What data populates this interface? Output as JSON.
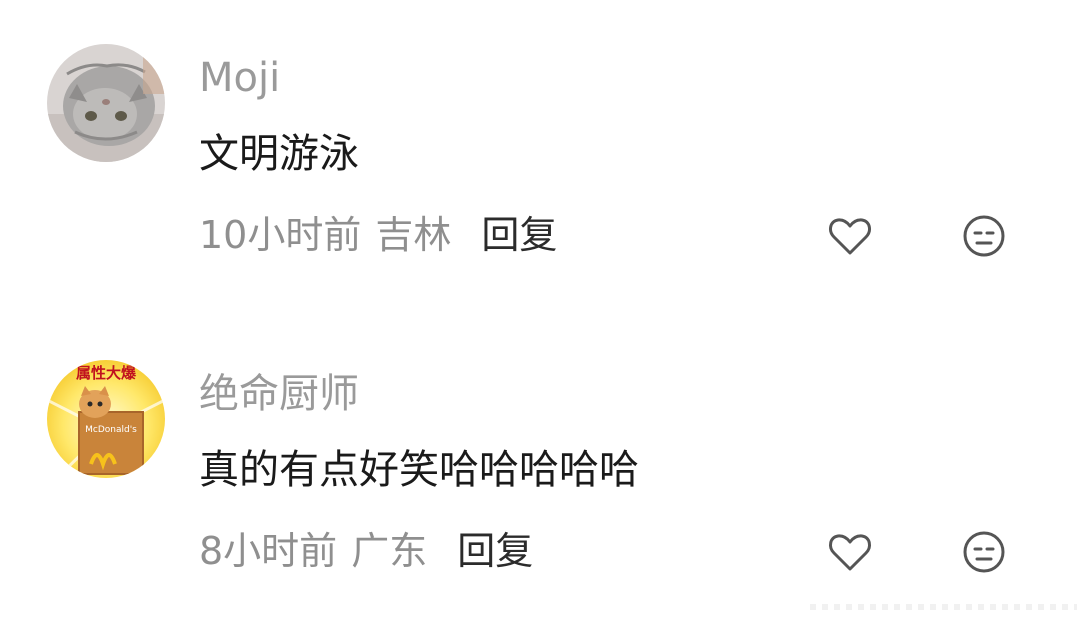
{
  "comments": [
    {
      "username": "Moji",
      "avatar_icon": "cat-avatar-icon",
      "text": "文明游泳",
      "time": "10小时前",
      "location": "吉林",
      "reply_label": "回复",
      "like_icon": "heart-icon",
      "dislike_icon": "neutral-face-icon"
    },
    {
      "username": "绝命厨师",
      "avatar_icon": "cat-mcdonalds-avatar-icon",
      "avatar_text": "属性大爆",
      "avatar_logo_text": "McDonald's",
      "text": "真的有点好笑哈哈哈哈哈",
      "time": "8小时前",
      "location": "广东",
      "reply_label": "回复",
      "like_icon": "heart-icon",
      "dislike_icon": "neutral-face-icon"
    }
  ],
  "colors": {
    "username": "#9a9a9a",
    "content": "#1a1a1a",
    "meta": "#8f8f8f",
    "reply": "#2b2b2b",
    "icon": "#555555"
  }
}
